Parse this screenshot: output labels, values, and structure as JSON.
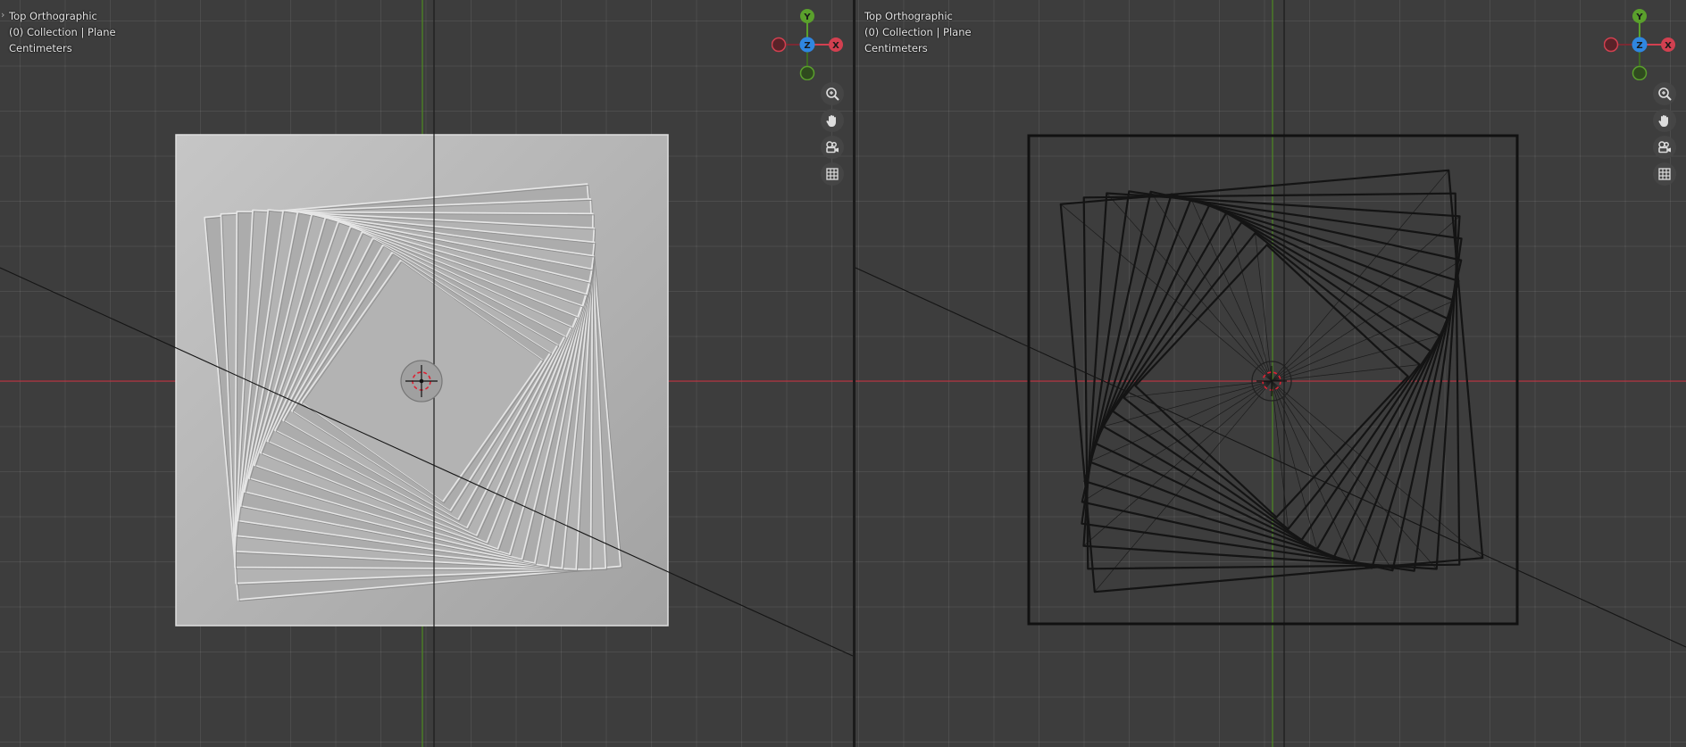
{
  "viewports": [
    {
      "id": "left",
      "shading": "solid",
      "overlay": {
        "view": "Top Orthographic",
        "collection": "(0) Collection | Plane",
        "units": "Centimeters"
      }
    },
    {
      "id": "right",
      "shading": "wireframe",
      "overlay": {
        "view": "Top Orthographic",
        "collection": "(0) Collection | Plane",
        "units": "Centimeters"
      }
    }
  ],
  "gizmo": {
    "y_label": "Y",
    "z_label": "Z",
    "x_label": "X"
  },
  "nav_buttons": [
    "zoom-icon",
    "pan-hand-icon",
    "camera-icon",
    "grid-toggle-icon"
  ],
  "colors": {
    "background": "#3d3d3d",
    "x_axis": "#d24050",
    "y_axis": "#5aa02c",
    "z_axis": "#2f86e0",
    "mesh_solid": "#b4b4b4",
    "wire": "#151515"
  }
}
